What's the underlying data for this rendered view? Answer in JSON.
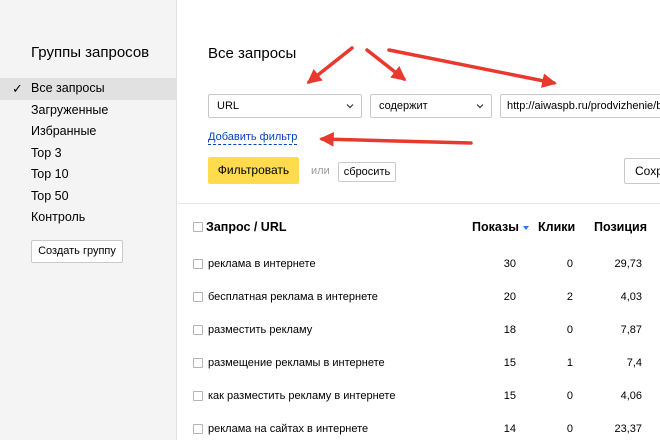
{
  "sidebar": {
    "title": "Группы запросов",
    "items": [
      {
        "label": "Все запросы",
        "active": true
      },
      {
        "label": "Загруженные",
        "active": false
      },
      {
        "label": "Избранные",
        "active": false
      },
      {
        "label": "Top 3",
        "active": false
      },
      {
        "label": "Top 10",
        "active": false
      },
      {
        "label": "Top 50",
        "active": false
      },
      {
        "label": "Контроль",
        "active": false
      }
    ],
    "create_group_label": "Создать группу"
  },
  "main": {
    "title": "Все запросы",
    "filter": {
      "field_value": "URL",
      "condition_value": "содержит",
      "value": "http://aiwaspb.ru/prodvizhenie/besplatnaya-reklama",
      "add_filter_label": "Добавить фильтр",
      "apply_label": "Фильтровать",
      "or_label": "или",
      "reset_label": "сбросить",
      "save_label": "Сохранить"
    },
    "table": {
      "columns": {
        "query": "Запрос / URL",
        "shows": "Показы",
        "clicks": "Клики",
        "position": "Позиция"
      },
      "rows": [
        {
          "query": "реклама в интернете",
          "shows": "30",
          "clicks": "0",
          "position": "29,73"
        },
        {
          "query": "бесплатная реклама в интернете",
          "shows": "20",
          "clicks": "2",
          "position": "4,03"
        },
        {
          "query": "разместить рекламу",
          "shows": "18",
          "clicks": "0",
          "position": "7,87"
        },
        {
          "query": "размещение рекламы в интернете",
          "shows": "15",
          "clicks": "1",
          "position": "7,4"
        },
        {
          "query": "как разместить рекламу в интернете",
          "shows": "15",
          "clicks": "0",
          "position": "4,06"
        },
        {
          "query": "реклама на сайтах в интернете",
          "shows": "14",
          "clicks": "0",
          "position": "23,37"
        }
      ]
    }
  },
  "colors": {
    "accent_button": "#ffdb4d",
    "link": "#0044bb",
    "annotation_arrow": "#e8392f",
    "sidebar_bg": "#f4f4f4"
  }
}
